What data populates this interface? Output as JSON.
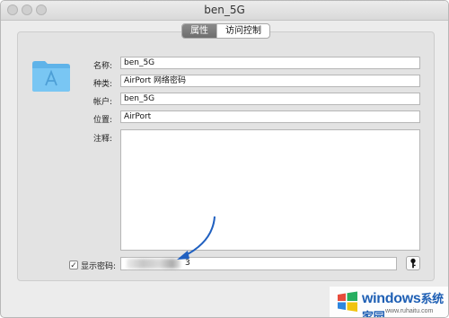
{
  "window": {
    "title": "ben_5G"
  },
  "tabs": [
    {
      "label": "属性",
      "active": true
    },
    {
      "label": "访问控制",
      "active": false
    }
  ],
  "icon": {
    "name": "keychain-folder-icon",
    "color": "#6bbff0"
  },
  "fields": {
    "name": {
      "label": "名称:",
      "value": "ben_5G"
    },
    "kind": {
      "label": "种类:",
      "value": "AirPort 网络密码"
    },
    "account": {
      "label": "帐户:",
      "value": "ben_5G"
    },
    "where": {
      "label": "位置:",
      "value": "AirPort"
    },
    "comments": {
      "label": "注释:",
      "value": ""
    }
  },
  "show_password": {
    "label": "显示密码:",
    "checked": true,
    "checkmark": "✓",
    "value_suffix": "3"
  },
  "watermark": {
    "brand": "windows",
    "brand_cn": "系统家园",
    "url": "www.ruhaitu.com"
  }
}
